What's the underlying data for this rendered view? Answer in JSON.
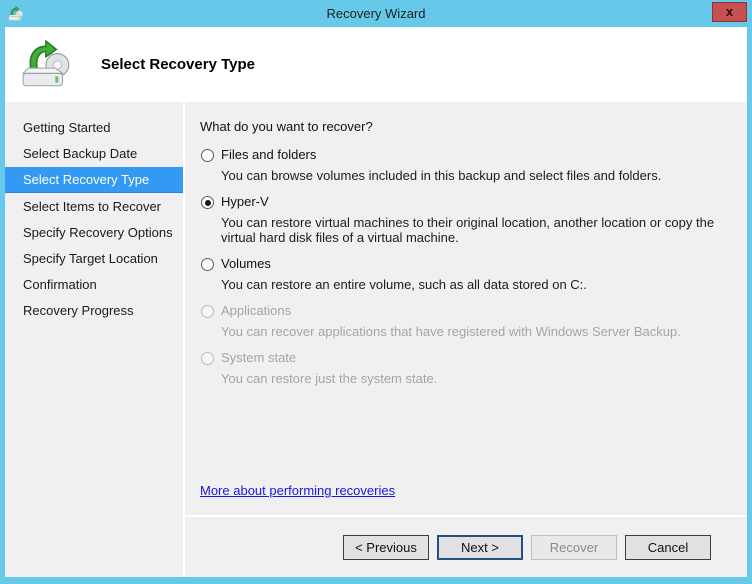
{
  "window": {
    "title": "Recovery Wizard",
    "close_label": "x"
  },
  "header": {
    "title": "Select Recovery Type"
  },
  "sidebar": {
    "items": [
      {
        "label": "Getting Started",
        "active": false
      },
      {
        "label": "Select Backup Date",
        "active": false
      },
      {
        "label": "Select Recovery Type",
        "active": true
      },
      {
        "label": "Select Items to Recover",
        "active": false
      },
      {
        "label": "Specify Recovery Options",
        "active": false
      },
      {
        "label": "Specify Target Location",
        "active": false
      },
      {
        "label": "Confirmation",
        "active": false
      },
      {
        "label": "Recovery Progress",
        "active": false
      }
    ]
  },
  "main": {
    "question": "What do you want to recover?",
    "options": [
      {
        "label": "Files and folders",
        "description": "You can browse volumes included in this backup and select files and folders.",
        "selected": false,
        "enabled": true
      },
      {
        "label": "Hyper-V",
        "description": "You can restore virtual machines to their original location, another location or copy the virtual hard disk files of a virtual machine.",
        "selected": true,
        "enabled": true
      },
      {
        "label": "Volumes",
        "description": "You can restore an entire volume, such as all data stored on C:.",
        "selected": false,
        "enabled": true
      },
      {
        "label": "Applications",
        "description": "You can recover applications that have registered with Windows Server Backup.",
        "selected": false,
        "enabled": false
      },
      {
        "label": "System state",
        "description": "You can restore just the system state.",
        "selected": false,
        "enabled": false
      }
    ],
    "link": "More about performing recoveries"
  },
  "footer": {
    "buttons": [
      {
        "label": "< Previous",
        "enabled": true,
        "focused": false
      },
      {
        "label": "Next >",
        "enabled": true,
        "focused": true
      },
      {
        "label": "Recover",
        "enabled": false,
        "focused": false
      },
      {
        "label": "Cancel",
        "enabled": true,
        "focused": false
      }
    ]
  },
  "colors": {
    "titlebar": "#67c9e9",
    "active_nav": "#3399f3",
    "close_button": "#c75050",
    "link": "#1a16e3",
    "focused_button_border": "#24527c",
    "panel_background": "#f0f0f0"
  }
}
